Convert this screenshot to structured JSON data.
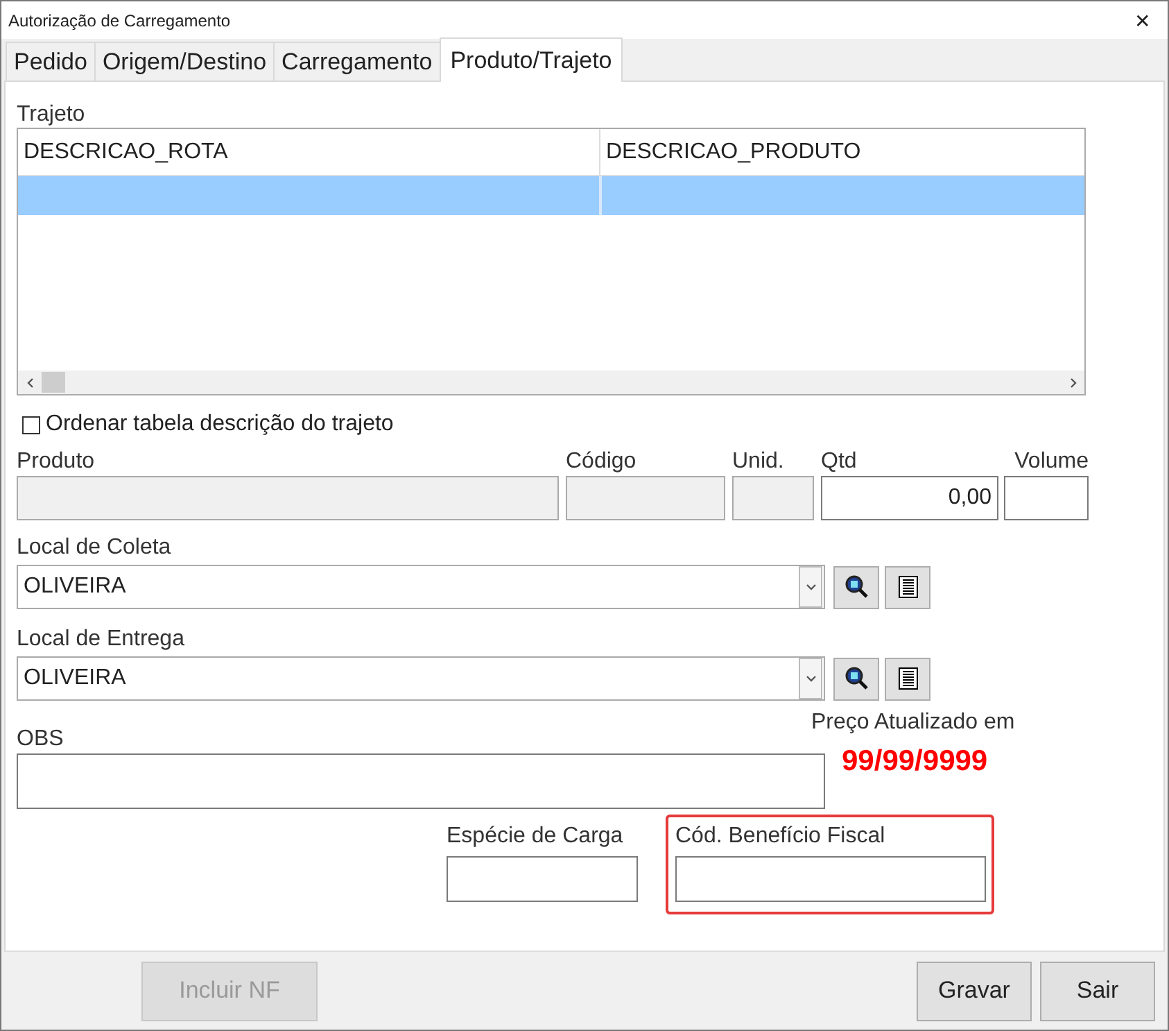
{
  "window": {
    "title": "Autorização de Carregamento",
    "close": "✕"
  },
  "tabs": [
    {
      "label": "Pedido",
      "selected": false
    },
    {
      "label": "Origem/Destino",
      "selected": false
    },
    {
      "label": "Carregamento",
      "selected": false
    },
    {
      "label": "Produto/Trajeto",
      "selected": true
    }
  ],
  "trajeto": {
    "label": "Trajeto",
    "columns": [
      "DESCRICAO_ROTA",
      "DESCRICAO_PRODUTO"
    ],
    "rows": [
      {
        "selected": true
      }
    ]
  },
  "order_checkbox": {
    "label": "Ordenar tabela descrição do trajeto",
    "checked": false
  },
  "product_fields": [
    {
      "label": "Produto",
      "disabled": true
    },
    {
      "label": "Código",
      "disabled": true
    },
    {
      "label": "Unid.",
      "disabled": true
    },
    {
      "label": "Qtd",
      "value": "0,00",
      "disabled": false
    },
    {
      "label": "Volume",
      "disabled": false
    }
  ],
  "local_coleta": {
    "label": "Local de Coleta",
    "value": "OLIVEIRA"
  },
  "local_entrega": {
    "label": "Local de Entrega",
    "value": "OLIVEIRA"
  },
  "obs": {
    "label": "OBS"
  },
  "price_update": {
    "label": "Preço Atualizado em",
    "date": "99/99/9999"
  },
  "especie_carga": {
    "label": "Espécie de Carga",
    "highlighted": false
  },
  "beneficio_fiscal": {
    "label": "Cód. Benefício Fiscal",
    "highlighted": true
  },
  "buttons": [
    {
      "label": "Incluir NF",
      "disabled": true
    },
    {
      "label": "Gravar",
      "disabled": false
    },
    {
      "label": "Sair",
      "disabled": false
    }
  ]
}
